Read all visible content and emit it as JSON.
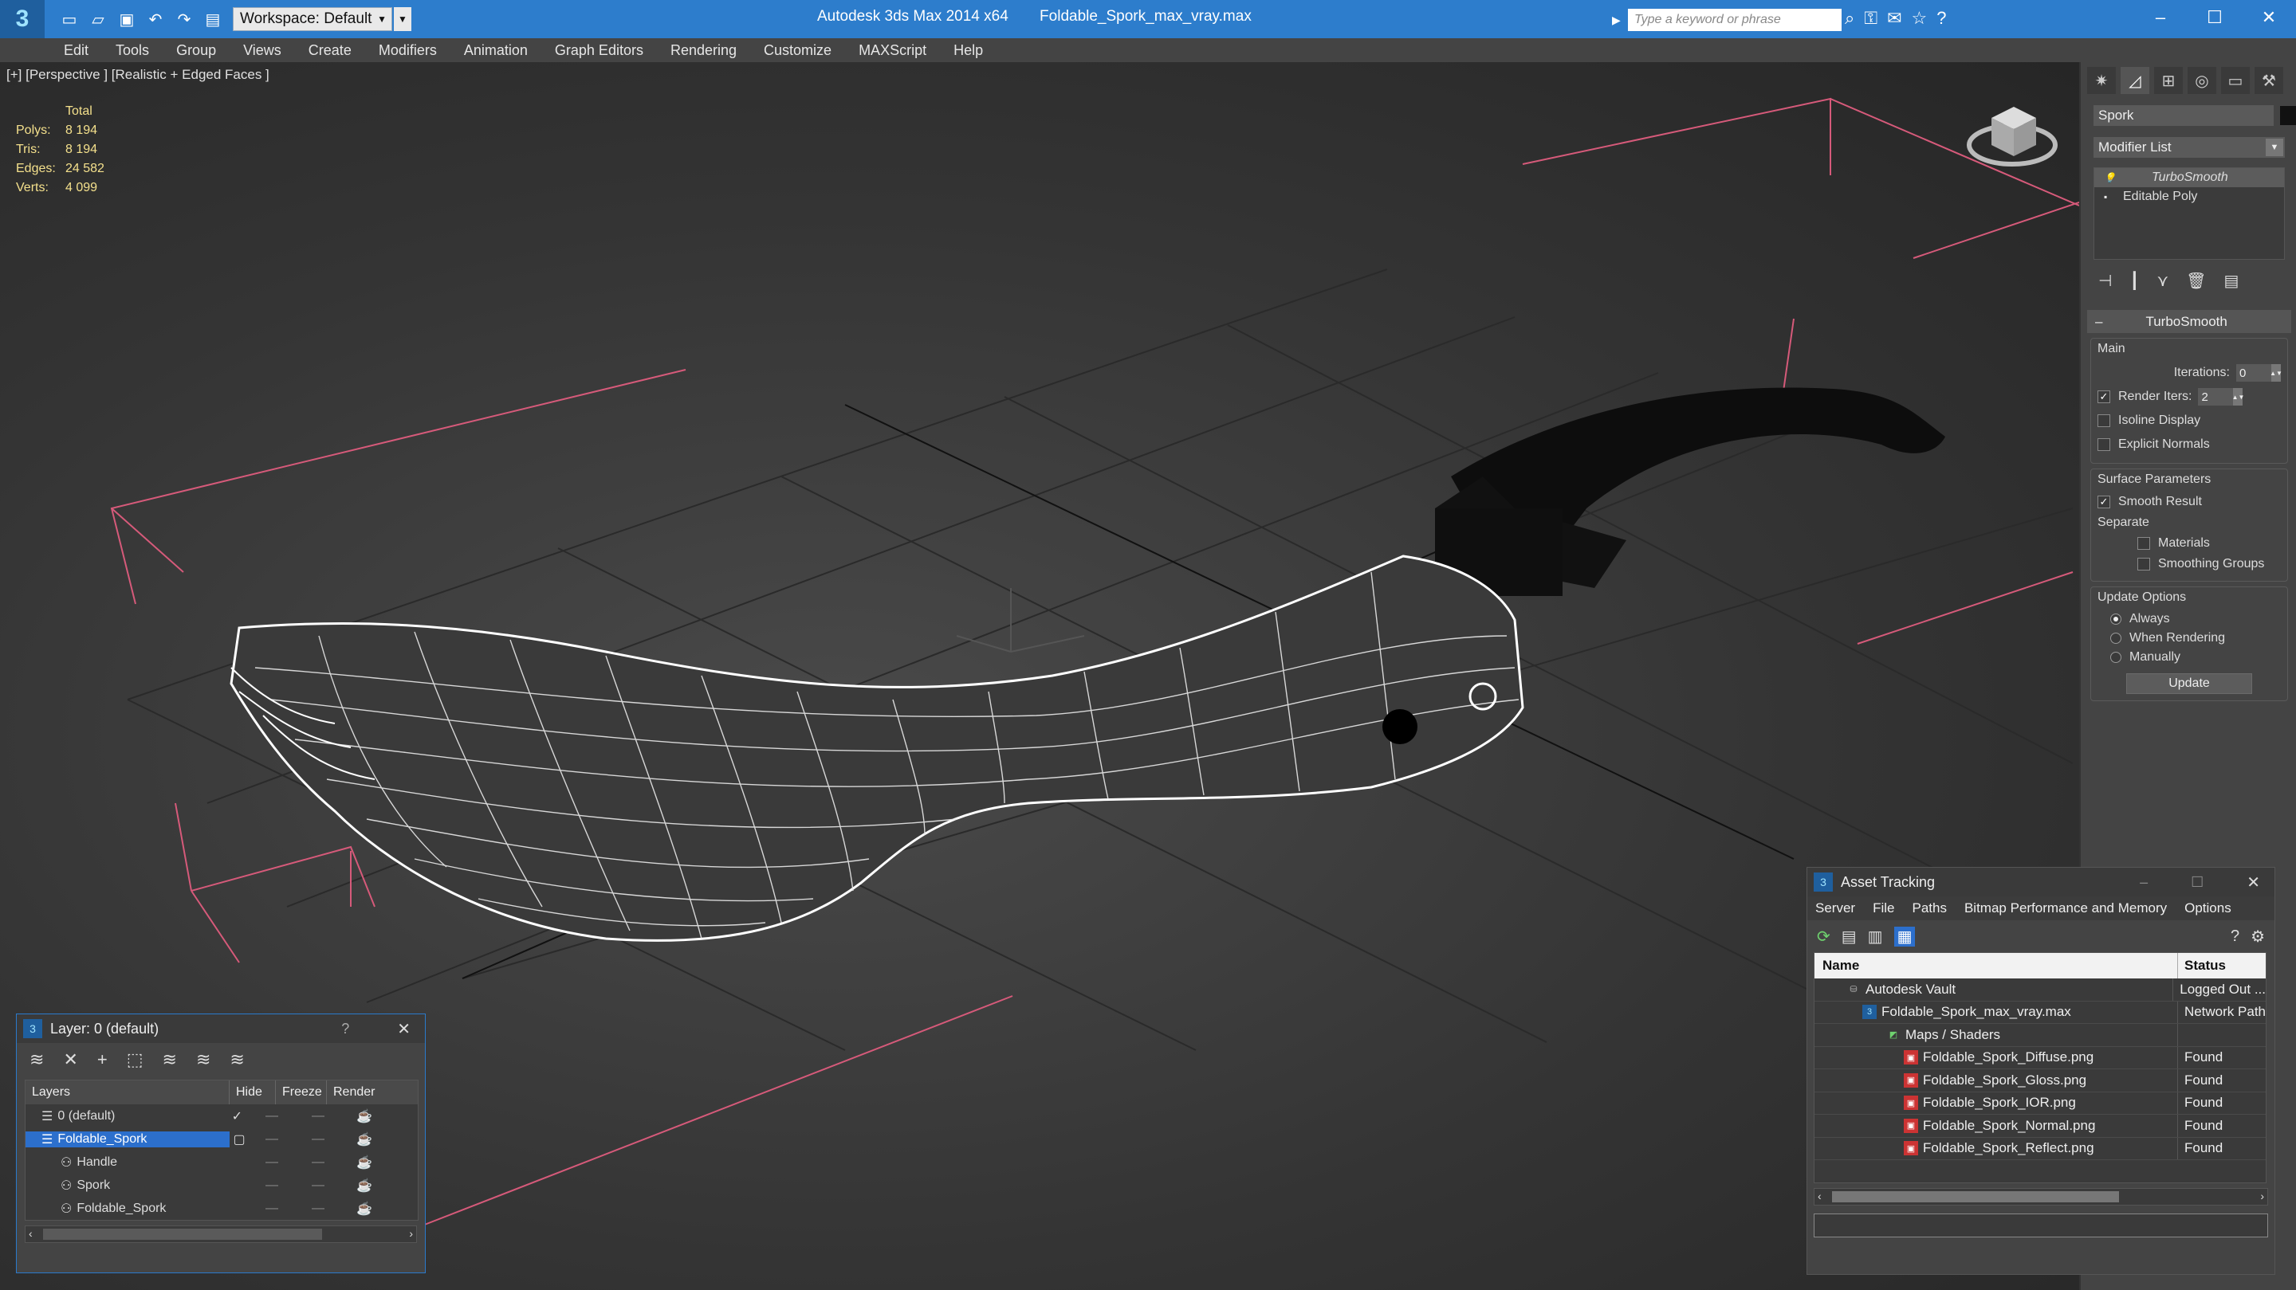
{
  "titlebar": {
    "workspace": "Workspace: Default",
    "app_name": "Autodesk 3ds Max  2014 x64",
    "file_name": "Foldable_Spork_max_vray.max",
    "search_placeholder": "Type a keyword or phrase"
  },
  "menu": [
    "Edit",
    "Tools",
    "Group",
    "Views",
    "Create",
    "Modifiers",
    "Animation",
    "Graph Editors",
    "Rendering",
    "Customize",
    "MAXScript",
    "Help"
  ],
  "viewport": {
    "label": "[+] [Perspective ] [Realistic + Edged Faces ]",
    "stats": {
      "header": "Total",
      "rows": [
        {
          "key": "Polys:",
          "value": "8 194"
        },
        {
          "key": "Tris:",
          "value": "8 194"
        },
        {
          "key": "Edges:",
          "value": "24 582"
        },
        {
          "key": "Verts:",
          "value": "4 099"
        }
      ]
    }
  },
  "command_panel": {
    "object_name": "Spork",
    "modifier_list": "Modifier List",
    "stack": [
      "TurboSmooth",
      "Editable Poly"
    ],
    "rollout_title": "TurboSmooth",
    "main_group": "Main",
    "iterations_label": "Iterations:",
    "iterations_value": "0",
    "render_iters_label": "Render Iters:",
    "render_iters_value": "2",
    "isoline_display": "Isoline Display",
    "explicit_normals": "Explicit Normals",
    "surface_group": "Surface Parameters",
    "smooth_result": "Smooth Result",
    "separate": "Separate",
    "materials": "Materials",
    "smoothing_groups": "Smoothing Groups",
    "update_group": "Update Options",
    "always": "Always",
    "when_rendering": "When Rendering",
    "manually": "Manually",
    "update_button": "Update"
  },
  "layer_dialog": {
    "title": "Layer: 0 (default)",
    "help": "?",
    "columns": [
      "Layers",
      "Hide",
      "Freeze",
      "Render"
    ],
    "rows": [
      {
        "name": "0 (default)"
      },
      {
        "name": "Foldable_Spork"
      },
      {
        "name": "Handle"
      },
      {
        "name": "Spork"
      },
      {
        "name": "Foldable_Spork"
      }
    ]
  },
  "asset_dialog": {
    "title": "Asset Tracking",
    "menu": [
      "Server",
      "File",
      "Paths",
      "Bitmap Performance and Memory",
      "Options"
    ],
    "columns": [
      "Name",
      "Status"
    ],
    "rows": [
      {
        "name": "Autodesk Vault",
        "status": "Logged Out ..."
      },
      {
        "name": "Foldable_Spork_max_vray.max",
        "status": "Network Path"
      },
      {
        "name": "Maps / Shaders",
        "status": ""
      },
      {
        "name": "Foldable_Spork_Diffuse.png",
        "status": "Found"
      },
      {
        "name": "Foldable_Spork_Gloss.png",
        "status": "Found"
      },
      {
        "name": "Foldable_Spork_IOR.png",
        "status": "Found"
      },
      {
        "name": "Foldable_Spork_Normal.png",
        "status": "Found"
      },
      {
        "name": "Foldable_Spork_Reflect.png",
        "status": "Found"
      }
    ]
  }
}
